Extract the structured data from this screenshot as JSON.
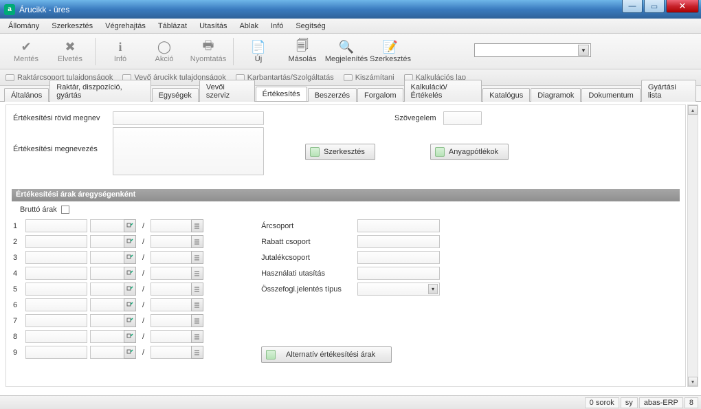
{
  "window": {
    "title": "Árucikk - üres"
  },
  "menu": [
    "Állomány",
    "Szerkesztés",
    "Végrehajtás",
    "Táblázat",
    "Utasítás",
    "Ablak",
    "Infó",
    "Segítség"
  ],
  "toolbar": {
    "mentes": "Mentés",
    "elvetes": "Elvetés",
    "info": "Infó",
    "akcio": "Akció",
    "nyomtatas": "Nyomtatás",
    "uj": "Új",
    "masolas": "Másolás",
    "megjelenites": "Megjelenítés",
    "szerkesztes": "Szerkesztés"
  },
  "links": [
    "Raktárcsoport tulajdonságok",
    "Vevő árucikk tulajdonságok",
    "Karbantartás/Szolgáltatás",
    "Kiszámítani",
    "Kalkulációs lap"
  ],
  "tabs": [
    "Általános",
    "Raktár, diszpozíció, gyártás",
    "Egységek",
    "Vevői szerviz",
    "Értékesítés",
    "Beszerzés",
    "Forgalom",
    "Kalkuláció/Értékelés",
    "Katalógus",
    "Diagramok",
    "Dokumentum",
    "Gyártási lista"
  ],
  "active_tab": 4,
  "form": {
    "short_name_label": "Értékesítési rövid megnev",
    "name_label": "Értékesítési megnevezés",
    "szovegelem_label": "Szövegelem",
    "edit_btn": "Szerkesztés",
    "anyag_btn": "Anyagpótlékok",
    "group_title": "Értékesítési árak áregységenként",
    "brutto_label": "Bruttó árak",
    "right_labels": [
      "Árcsoport",
      "Rabatt csoport",
      "Jutalékcsoport",
      "Használati utasítás",
      "Összefogl.jelentés típus"
    ],
    "rows": [
      "1",
      "2",
      "3",
      "4",
      "5",
      "6",
      "7",
      "8",
      "9"
    ],
    "alt_btn": "Alternatív értékesítési árak"
  },
  "status": {
    "sorok": "0 sorok",
    "sy": "sy",
    "app": "abas-ERP",
    "n": "8"
  }
}
